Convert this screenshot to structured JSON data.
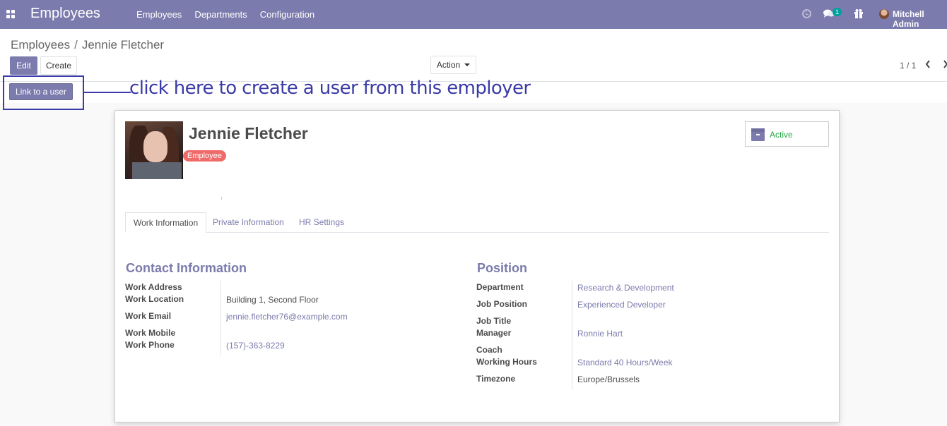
{
  "navbar": {
    "app_title": "Employees",
    "menu": [
      "Employees",
      "Departments",
      "Configuration"
    ],
    "chat_badge": "1",
    "user_name": "Mitchell Admin"
  },
  "breadcrumb": {
    "parent": "Employees",
    "separator": "/",
    "current": "Jennie Fletcher"
  },
  "buttons": {
    "edit": "Edit",
    "create": "Create",
    "action": "Action",
    "link_user": "Link to a user"
  },
  "pager": {
    "text": "1 / 1"
  },
  "annotation": {
    "text": "click here to create a user from this employer"
  },
  "employee": {
    "name": "Jennie Fletcher",
    "tag": "Employee",
    "status": "Active"
  },
  "tabs": [
    "Work Information",
    "Private Information",
    "HR Settings"
  ],
  "contact": {
    "title": "Contact Information",
    "labels": [
      "Work Address",
      "Work Location",
      "Work Email",
      "Work Mobile",
      "Work Phone"
    ],
    "work_location": "Building 1, Second Floor",
    "work_email": "jennie.fletcher76@example.com",
    "work_phone": "(157)-363-8229"
  },
  "position": {
    "title": "Position",
    "labels": [
      "Department",
      "Job Position",
      "Job Title",
      "Manager",
      "Coach",
      "Working Hours",
      "Timezone"
    ],
    "department": "Research & Development",
    "job_position": "Experienced Developer",
    "manager": "Ronnie Hart",
    "working_hours": "Standard 40 Hours/Week",
    "timezone": "Europe/Brussels"
  },
  "colors": {
    "brand": "#7c7bad",
    "annotation": "#3a3aa8",
    "active": "#28a745",
    "tag": "#f06a6a"
  }
}
